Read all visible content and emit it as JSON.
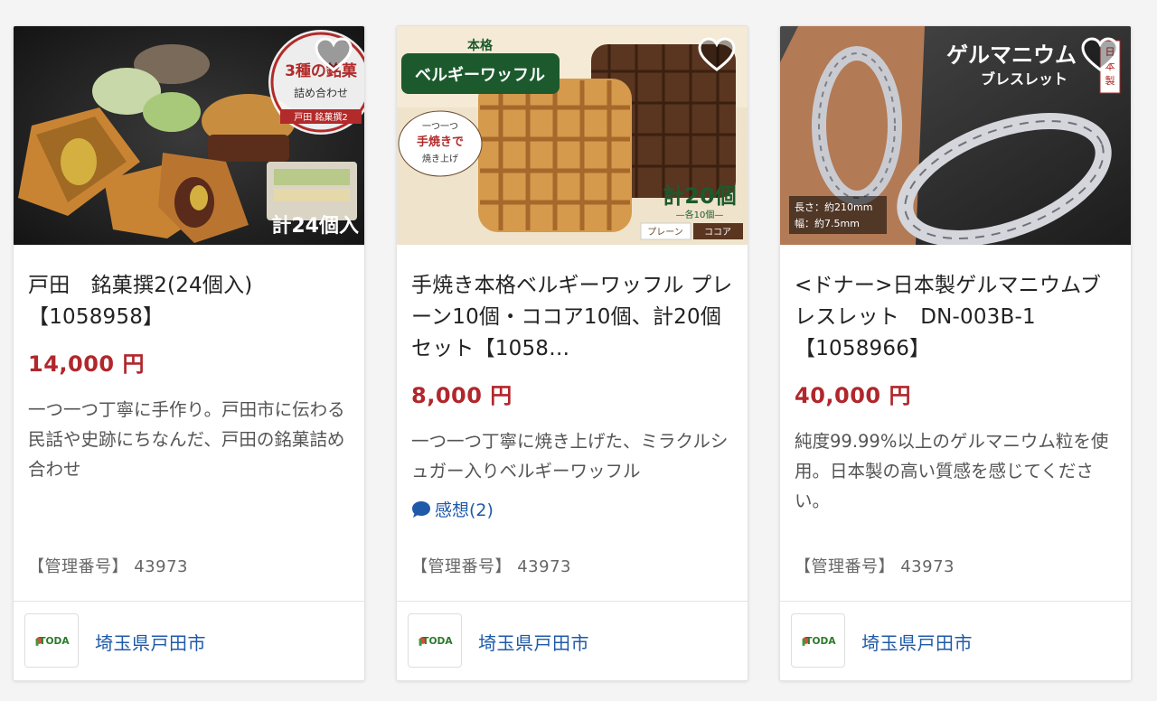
{
  "items": [
    {
      "title": "戸田　銘菓撰2(24個入)【1058958】",
      "price": "14,000 円",
      "description": "一つ一つ丁寧に手作り。戸田市に伝わる民話や史跡にちなんだ、戸田の銘菓詰め合わせ",
      "management": "【管理番号】 43973",
      "city": "埼玉県戸田市",
      "image_text": {
        "badge_line1": "3種の銘菓",
        "badge_line2": "詰め合わせ",
        "badge_line3": "戸田 銘菓撰2",
        "count": "計24個入"
      }
    },
    {
      "title": "手焼き本格ベルギーワッフル プレーン10個・ココア10個、計20個セット【1058…",
      "price": "8,000 円",
      "description": "一つ一つ丁寧に焼き上げた、ミラクルシュガー入りベルギーワッフル",
      "review": "感想(2)",
      "management": "【管理番号】 43973",
      "city": "埼玉県戸田市",
      "image_text": {
        "banner_top": "本格",
        "banner_main": "ベルギーワッフル",
        "bubble_line1": "一つ一つ",
        "bubble_line2": "手焼きで",
        "bubble_line3": "焼き上げ",
        "count": "計20個",
        "count_sub": "—各10個—",
        "tag_plain": "プレーン",
        "tag_cocoa": "ココア"
      }
    },
    {
      "title": "<ドナー>日本製ゲルマニウムブレスレット　DN-003B-1【1058966】",
      "price": "40,000 円",
      "description": "純度99.99%以上のゲルマニウム粒を使用。日本製の高い質感を感じてください。",
      "management": "【管理番号】 43973",
      "city": "埼玉県戸田市",
      "image_text": {
        "heading1": "ゲルマニウム",
        "heading2": "ブレスレット",
        "made_in": "日本製",
        "spec1": "長さ：約210mm",
        "spec2": "幅：約7.5mm"
      }
    }
  ],
  "logo_text": "TODA",
  "colors": {
    "price": "#b0272c",
    "link": "#1f5aa8"
  }
}
